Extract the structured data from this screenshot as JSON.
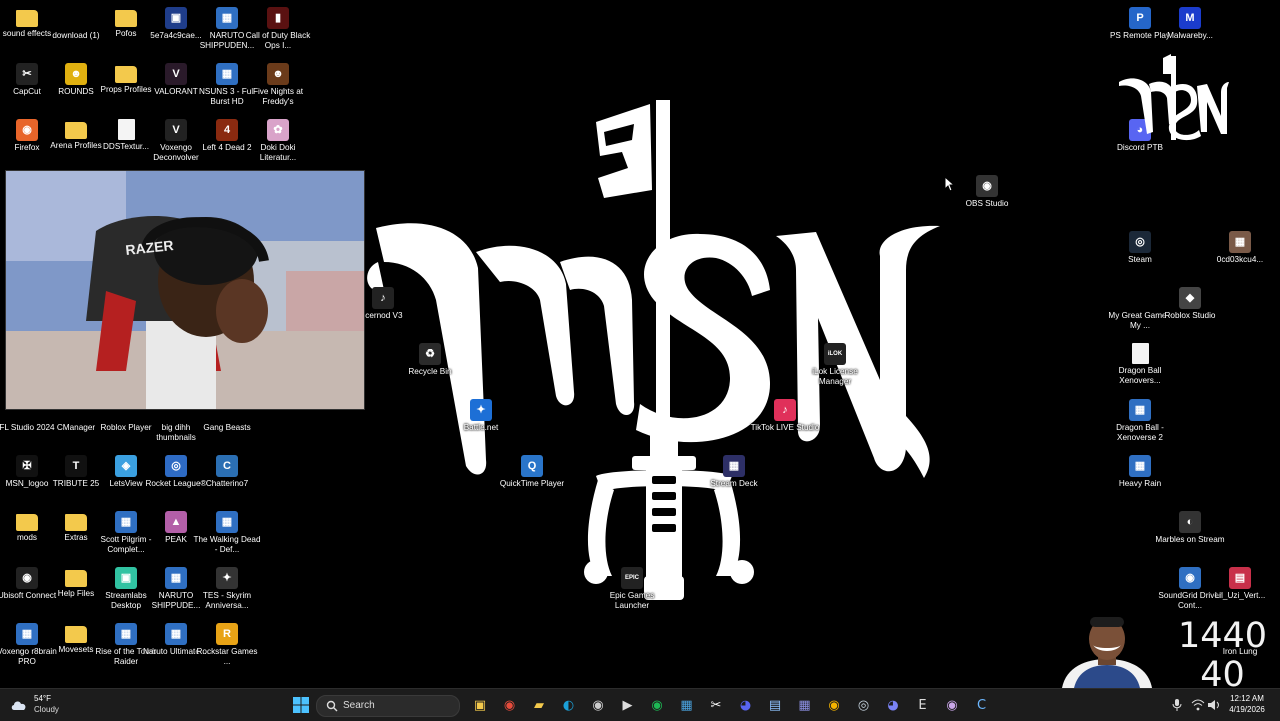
{
  "desktop": {
    "icons": [
      {
        "label": "sound effects",
        "glyph": "folder",
        "color": "#f3c94c"
      },
      {
        "label": "download (1)",
        "glyph": "",
        "color": "#000000"
      },
      {
        "label": "Pofos",
        "glyph": "folder",
        "color": "#f3c94c"
      },
      {
        "label": "5e7a4c9cae...",
        "glyph": "▣",
        "color": "#1f3d8a"
      },
      {
        "label": "NARUTO SHIPPUDEN...",
        "glyph": "▦",
        "color": "#2f6fc2"
      },
      {
        "label": "Call of Duty Black Ops I...",
        "glyph": "▮",
        "color": "#5a1111"
      },
      {
        "label": "CapCut",
        "glyph": "✂",
        "color": "#222222"
      },
      {
        "label": "ROUNDS",
        "glyph": "☻",
        "color": "#e0b010"
      },
      {
        "label": "Props Profiles",
        "glyph": "folder",
        "color": "#f3c94c"
      },
      {
        "label": "VALORANT",
        "glyph": "V",
        "color": "#2a1a2a"
      },
      {
        "label": "NSUNS 3 - Full Burst HD",
        "glyph": "▦",
        "color": "#2f6fc2"
      },
      {
        "label": "Five Nights at Freddy's",
        "glyph": "☻",
        "color": "#6b3b1a"
      },
      {
        "label": "Firefox",
        "glyph": "◉",
        "color": "#e8652a"
      },
      {
        "label": "Arena Profiles",
        "glyph": "folder",
        "color": "#f3c94c"
      },
      {
        "label": "DDSTextur...",
        "glyph": "file",
        "color": "#f4f4f4"
      },
      {
        "label": "Voxengo Deconvolver",
        "glyph": "V",
        "color": "#222222"
      },
      {
        "label": "Left 4 Dead 2",
        "glyph": "4",
        "color": "#8a2a10"
      },
      {
        "label": "Doki Doki Literatur...",
        "glyph": "✿",
        "color": "#d9a3c9"
      },
      {
        "label": "FL Studio 2024",
        "glyph": "",
        "color": "#000000"
      },
      {
        "label": "CManager",
        "glyph": "",
        "color": "#000000"
      },
      {
        "label": "Roblox Player",
        "glyph": "",
        "color": "#000000"
      },
      {
        "label": "big dihh thumbnails",
        "glyph": "",
        "color": "#000000"
      },
      {
        "label": "Gang Beasts",
        "glyph": "",
        "color": "#000000"
      },
      {
        "label": "MSN_logoo",
        "glyph": "✠",
        "color": "#111111"
      },
      {
        "label": "TRIBUTE 25",
        "glyph": "T",
        "color": "#111111"
      },
      {
        "label": "LetsView",
        "glyph": "◈",
        "color": "#3ba0e0"
      },
      {
        "label": "Rocket League®",
        "glyph": "◎",
        "color": "#2e6bc4"
      },
      {
        "label": "Chatterino7",
        "glyph": "C",
        "color": "#2b6fb3"
      },
      {
        "label": "mods",
        "glyph": "folder",
        "color": "#f3c94c"
      },
      {
        "label": "Extras",
        "glyph": "folder",
        "color": "#f3c94c"
      },
      {
        "label": "Scott Pilgrim - Complet...",
        "glyph": "▦",
        "color": "#2f6fc2"
      },
      {
        "label": "PEAK",
        "glyph": "▲",
        "color": "#b35fa8"
      },
      {
        "label": "The Walking Dead - Def...",
        "glyph": "▦",
        "color": "#2f6fc2"
      },
      {
        "label": "Ubisoft Connect",
        "glyph": "◉",
        "color": "#222222"
      },
      {
        "label": "Help Files",
        "glyph": "folder",
        "color": "#f3c94c"
      },
      {
        "label": "Streamlabs Desktop",
        "glyph": "▣",
        "color": "#31c3a2"
      },
      {
        "label": "NARUTO SHIPPUDE...",
        "glyph": "▦",
        "color": "#2f6fc2"
      },
      {
        "label": "TES - Skyrim Anniversa...",
        "glyph": "✦",
        "color": "#333333"
      },
      {
        "label": "Voxengo r8brain PRO",
        "glyph": "▦",
        "color": "#2f6fc2"
      },
      {
        "label": "Movesets",
        "glyph": "folder",
        "color": "#f3c94c"
      },
      {
        "label": "Rise of the Tomb Raider",
        "glyph": "▦",
        "color": "#2f6fc2"
      },
      {
        "label": "Naruto Ultimate ...",
        "glyph": "▦",
        "color": "#2f6fc2"
      },
      {
        "label": "Rockstar Games ...",
        "glyph": "R",
        "color": "#e8a316"
      },
      {
        "label": "icernod V3",
        "glyph": "♪",
        "color": "#222222"
      },
      {
        "label": "Recycle Bin",
        "glyph": "♻",
        "color": "#2a2a2a"
      },
      {
        "label": "Battle.net",
        "glyph": "✦",
        "color": "#1d6fd6"
      },
      {
        "label": "QuickTime Player",
        "glyph": "Q",
        "color": "#2a75c9"
      },
      {
        "label": "Epic Games Launcher",
        "glyph": "EPIC",
        "color": "#222222"
      },
      {
        "label": "Stream Deck",
        "glyph": "▦",
        "color": "#2d2f66"
      },
      {
        "label": "TikTok LIVE Studio",
        "glyph": "♪",
        "color": "#e0305a"
      },
      {
        "label": "iLok License Manager",
        "glyph": "iLOK",
        "color": "#222222"
      },
      {
        "label": "OBS Studio",
        "glyph": "◉",
        "color": "#333333"
      },
      {
        "label": "PS Remote Play",
        "glyph": "P",
        "color": "#2566c9"
      },
      {
        "label": "Malwareby...",
        "glyph": "M",
        "color": "#1b3ccc"
      },
      {
        "label": "Discord PTB",
        "glyph": "◕",
        "color": "#5865f2"
      },
      {
        "label": "Steam",
        "glyph": "◎",
        "color": "#1b2838"
      },
      {
        "label": "0cd03kcu4...",
        "glyph": "▦",
        "color": "#7a5a48"
      },
      {
        "label": "My Great Game - My ...",
        "glyph": "",
        "color": "#000000"
      },
      {
        "label": "Roblox Studio",
        "glyph": "◆",
        "color": "#444444"
      },
      {
        "label": "Dragon Ball Xenovers...",
        "glyph": "file",
        "color": "#f4f4f4"
      },
      {
        "label": "Dragon Ball - Xenoverse 2",
        "glyph": "▦",
        "color": "#2f6fc2"
      },
      {
        "label": "Heavy Rain",
        "glyph": "▦",
        "color": "#2f6fc2"
      },
      {
        "label": "Marbles on Stream",
        "glyph": "◐",
        "color": "#333333"
      },
      {
        "label": "SoundGrid Driver Cont...",
        "glyph": "◉",
        "color": "#2f6fc2"
      },
      {
        "label": "Lil_Uzi_Vert...",
        "glyph": "▤",
        "color": "#c8304a"
      },
      {
        "label": "Iron Lung",
        "glyph": "",
        "color": "#000000"
      }
    ]
  },
  "overlay": {
    "counter_top": "1440",
    "counter_bottom": "40"
  },
  "taskbar": {
    "weather": {
      "temp": "54°F",
      "condition": "Cloudy"
    },
    "search_placeholder": "Search",
    "apps": [
      {
        "name": "file-explorer-icon",
        "glyph": "▣",
        "color": "#f3c94c"
      },
      {
        "name": "chrome-icon",
        "glyph": "◉",
        "color": "#e74c3c"
      },
      {
        "name": "folder-icon",
        "glyph": "▰",
        "color": "#f3c94c"
      },
      {
        "name": "edge-icon",
        "glyph": "◐",
        "color": "#1ba0d8"
      },
      {
        "name": "obs-icon",
        "glyph": "◉",
        "color": "#cccccc"
      },
      {
        "name": "media-player-icon",
        "glyph": "▶",
        "color": "#dddddd"
      },
      {
        "name": "spotify-icon",
        "glyph": "◉",
        "color": "#1db954"
      },
      {
        "name": "store-icon",
        "glyph": "▦",
        "color": "#4aa3df"
      },
      {
        "name": "capcut-icon",
        "glyph": "✂",
        "color": "#ffffff"
      },
      {
        "name": "discord-icon",
        "glyph": "◕",
        "color": "#5865f2"
      },
      {
        "name": "notepad-icon",
        "glyph": "▤",
        "color": "#8fc3ff"
      },
      {
        "name": "stream-deck-icon",
        "glyph": "▦",
        "color": "#8a8ee0"
      },
      {
        "name": "chrome-alt-icon",
        "glyph": "◉",
        "color": "#f4b400"
      },
      {
        "name": "steam-icon",
        "glyph": "◎",
        "color": "#c7d5e0"
      },
      {
        "name": "discord-ptb-icon",
        "glyph": "◕",
        "color": "#7a83f5"
      },
      {
        "name": "epic-games-icon",
        "glyph": "E",
        "color": "#dddddd"
      },
      {
        "name": "app-icon",
        "glyph": "◉",
        "color": "#c9a6e8"
      },
      {
        "name": "chatterino-icon",
        "glyph": "C",
        "color": "#6cb7ff"
      }
    ],
    "clock": {
      "time": "12:12 AM",
      "date": "4/19/2026"
    }
  },
  "colors": {
    "taskbar_bg": "#1c1c1c",
    "desktop_bg": "#000000",
    "logo": "#ffffff"
  }
}
